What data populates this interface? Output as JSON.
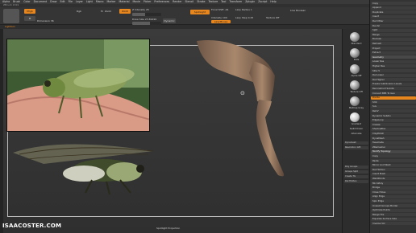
{
  "menubar": {
    "items": [
      "Alpha",
      "Brush",
      "Color",
      "Document",
      "Draw",
      "Edit",
      "File",
      "Layer",
      "Light",
      "Macro",
      "Marker",
      "Material",
      "Movie",
      "Picker",
      "Preferences",
      "Render",
      "Stencil",
      "Stroke",
      "Texture",
      "Tool",
      "Transform",
      "Zplugin",
      "Zscript",
      "Help"
    ]
  },
  "title": "ZBrush 2019",
  "topbar": {
    "mrgb": "Mrgb",
    "rgb": "Rgb",
    "m": "M",
    "zadd": "Zadd",
    "zsub": "Zsub",
    "z_intensity": "Z Intensity 25",
    "draw_size": "Draw Size 23.89199",
    "dynamic": "Dynamic",
    "focal_shift": "Focal Shift -44",
    "intensity": "Intensity 100",
    "spotlight": "SpotLight",
    "lazy_radius": "Lazy Radius 1",
    "lazy_step": "Lazy Step 0.25",
    "lazy_mouse": "LazyMouse",
    "live_boolean": "Live Boolean",
    "texture_off": "Texture Off",
    "dimension": "Dimension 36",
    "zaddmode": "ZAdd"
  },
  "subbar": {
    "label": "Lightbox"
  },
  "viewport": {
    "bottom_label": "Spotlight Projection",
    "zadd_slider": 0.45,
    "draw_size_slider": 0.6
  },
  "shelf": {
    "buttons": [
      "BPR",
      "SPix 3",
      "Persp",
      "Floor",
      "Local",
      "Frame",
      "Move",
      "Scale",
      "Rotate",
      "PolyF",
      "Transp",
      "Solo"
    ],
    "material_label": "MatCap Gray",
    "brush_label": "Standard",
    "stroke_label": "Dots",
    "alpha_label": "Alpha Off",
    "texture_label": "Texture Off",
    "gradient_label": "Gradient",
    "switch_color": "SwitchColor",
    "alternate": "Alternate",
    "dynamesh_label": "Dynamesh",
    "resolution_label": "Resolution 128",
    "poly_groups": "Poly Groups",
    "groups_split": "Groups Split",
    "del_hidden": "Del Hidden",
    "create_tg": "Create TG"
  },
  "panel": {
    "rows": [
      "Copy",
      "Append",
      "Duplicate",
      "Insert",
      "Del Other",
      "Del All",
      "Split",
      "Merge",
      "Boolean",
      "Remesh",
      "Project",
      "Extract",
      "Geometry",
      "Lower Res",
      "Higher Res",
      "SDiv 5",
      "Del Lower",
      "Del Higher",
      "Freeze SubDivision Levels",
      "Reconstruct Subdiv",
      "Convert BPR To Geo",
      "Divide",
      "Smt",
      "Suv",
      "ReUV",
      "Dynamic Subdiv",
      "EdgeLoop",
      "Crease",
      "ShadowBox",
      "ClayPolish",
      "DynaMesh",
      "Tessimate",
      "ZRemesher",
      "Modify Topology",
      "Copy",
      "Paste",
      "Mirror And Weld",
      "Del Hidden",
      "Insert Mesh",
      "WeldPoints",
      "MicroPoly",
      "Bridge",
      "Close Holes",
      "Align Edge",
      "Spin Edge",
      "Unweld Groups Border",
      "Optimize Points",
      "Merge Tris",
      "Equalize Surface Size",
      "Inverse Vol"
    ],
    "extract_thickness": "Thick 0.02",
    "sdiv_value": "SDiv 5",
    "active_highlight": "Divide"
  },
  "watermark": "ISAACOSTER.COM",
  "colors": {
    "accent": "#e8861e",
    "background": "#2b2b2b",
    "panel": "#343434",
    "sculpt": "#9b7b63"
  }
}
